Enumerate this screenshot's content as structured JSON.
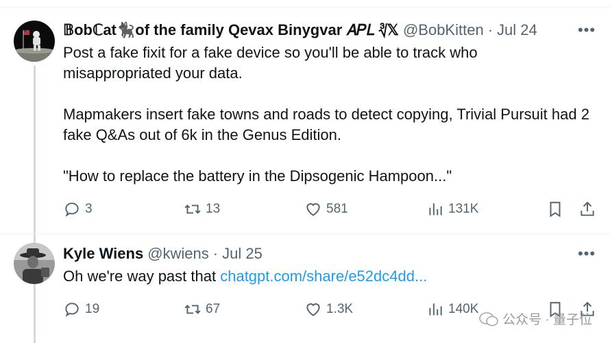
{
  "tweets": [
    {
      "author": {
        "name": "𝔹obℂat🐈‍⬛of the family Qevax Binygvar 𝐴𝑃𝐿 ∛𝕏",
        "handle": "@BobKitten",
        "date": "Jul 24"
      },
      "paragraphs": [
        "Post a fake fixit for a fake device so you'll be able to track who misappropriated your data.",
        "Mapmakers insert fake towns and roads to detect copying, Trivial Pursuit had 2 fake Q&As out of 6k in the Genus Edition.",
        "\"How to replace the battery in the Dipsogenic Hampoon...\""
      ],
      "stats": {
        "replies": "3",
        "reposts": "13",
        "likes": "581",
        "views": "131K"
      }
    },
    {
      "author": {
        "name": "Kyle Wiens",
        "handle": "@kwiens",
        "date": "Jul 25"
      },
      "text": "Oh we're way past that",
      "link_text": "chatgpt.com/share/e52dc4dd...",
      "stats": {
        "replies": "19",
        "reposts": "67",
        "likes": "1.3K",
        "views": "140K"
      }
    }
  ],
  "separator": "·",
  "more_label": "•••",
  "watermark": {
    "text": "公众号 · 量子位"
  },
  "icons": {
    "reply": "reply-icon",
    "repost": "repost-icon",
    "like": "heart-icon",
    "views": "views-icon",
    "bookmark": "bookmark-icon",
    "share": "share-icon"
  },
  "colors": {
    "text": "#0f1419",
    "muted": "#536471",
    "link": "#1d9bf0",
    "thread_line": "#cfd9de"
  }
}
